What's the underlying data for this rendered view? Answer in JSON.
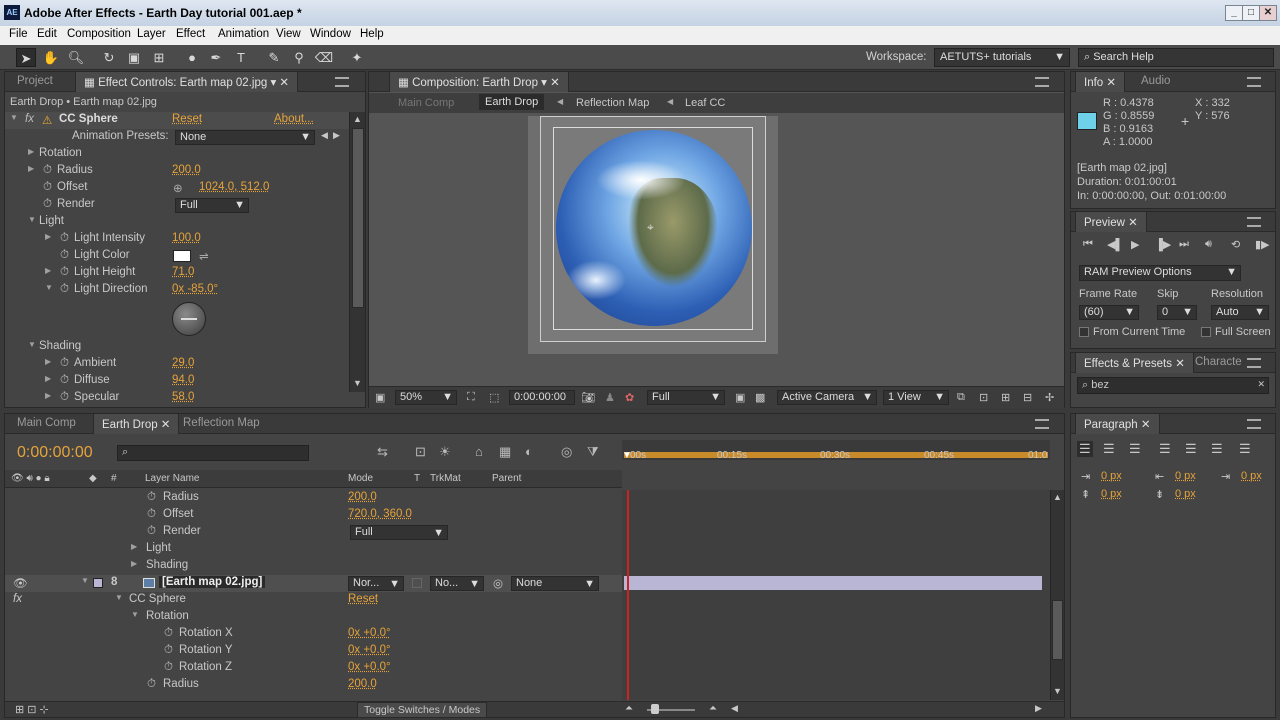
{
  "window": {
    "title": "Adobe After Effects - Earth Day tutorial 001.aep *",
    "logo": "AE",
    "min": "_",
    "max": "□",
    "close": "✕"
  },
  "menu": [
    "File",
    "Edit",
    "Composition",
    "Layer",
    "Effect",
    "Animation",
    "View",
    "Window",
    "Help"
  ],
  "toolbar": {
    "workspace_label": "Workspace:",
    "workspace_value": "AETUTS+ tutorials",
    "search_placeholder": "Search Help"
  },
  "left_panel": {
    "tabs": [
      "Project",
      "Effect Controls: Earth map 02.jpg"
    ],
    "breadcrumb": "Earth Drop • Earth map 02.jpg",
    "effect": {
      "fx": "fx",
      "name": "CC Sphere",
      "reset": "Reset",
      "about": "About...",
      "presets_label": "Animation Presets:",
      "presets_value": "None"
    },
    "props": {
      "rotation": "Rotation",
      "radius": {
        "label": "Radius",
        "value": "200.0"
      },
      "offset": {
        "label": "Offset",
        "value": "1024.0, 512.0"
      },
      "render": {
        "label": "Render",
        "value": "Full"
      },
      "light": "Light",
      "light_intensity": {
        "label": "Light Intensity",
        "value": "100.0"
      },
      "light_color": {
        "label": "Light Color"
      },
      "light_height": {
        "label": "Light Height",
        "value": "71.0"
      },
      "light_direction": {
        "label": "Light Direction",
        "value": "0x -85.0°"
      },
      "shading": "Shading",
      "ambient": {
        "label": "Ambient",
        "value": "29.0"
      },
      "diffuse": {
        "label": "Diffuse",
        "value": "94.0"
      },
      "specular": {
        "label": "Specular",
        "value": "58.0"
      }
    }
  },
  "comp_panel": {
    "tab": "Composition: Earth Drop",
    "crumbs": [
      "Main Comp",
      "Earth Drop",
      "Reflection Map",
      "Leaf CC"
    ],
    "zoom": "50%",
    "timecode": "0:00:00:00",
    "resolution": "Full",
    "camera": "Active Camera",
    "view": "1 View"
  },
  "info_panel": {
    "tabs": [
      "Info",
      "Audio"
    ],
    "r": "R : 0.4378",
    "g": "G : 0.8559",
    "b": "B : 0.9163",
    "a": "A : 1.0000",
    "x": "X : 332",
    "y": "Y : 576",
    "swatch_color": "#6fd0ea",
    "file": "[Earth map 02.jpg]",
    "duration": "Duration: 0:01:00:01",
    "inout": "In: 0:00:00:00, Out: 0:01:00:00"
  },
  "preview_panel": {
    "tab": "Preview",
    "ram_options": "RAM Preview Options",
    "frame_rate_label": "Frame Rate",
    "skip_label": "Skip",
    "resolution_label": "Resolution",
    "frame_rate": "(60)",
    "skip": "0",
    "resolution": "Auto",
    "from_current": "From Current Time",
    "full_screen": "Full Screen"
  },
  "effects_panel": {
    "tabs": [
      "Effects & Presets",
      "Characte"
    ],
    "search": "bez"
  },
  "paragraph_panel": {
    "tab": "Paragraph",
    "px": "0 px"
  },
  "timeline": {
    "tabs": [
      "Main Comp",
      "Earth Drop",
      "Reflection Map"
    ],
    "timecode": "0:00:00:00",
    "cols": {
      "hash": "#",
      "layer": "Layer Name",
      "mode": "Mode",
      "t": "T",
      "trkmat": "TrkMat",
      "parent": "Parent"
    },
    "ruler": [
      "00s",
      "00:15s",
      "00:30s",
      "00:45s",
      "01:0"
    ],
    "rows": [
      {
        "label": "Radius",
        "value": "200.0"
      },
      {
        "label": "Offset",
        "value": "720.0, 360.0"
      },
      {
        "label": "Render",
        "value": "Full"
      },
      {
        "label": "Light"
      },
      {
        "label": "Shading"
      }
    ],
    "layer": {
      "num": "8",
      "name": "[Earth map 02.jpg]",
      "mode": "Nor...",
      "trkmat": "No...",
      "parent": "None"
    },
    "effect": {
      "name": "CC Sphere",
      "reset": "Reset",
      "sub": "Rotation",
      "rx": {
        "label": "Rotation X",
        "value": "0x +0.0°"
      },
      "ry": {
        "label": "Rotation Y",
        "value": "0x +0.0°"
      },
      "rz": {
        "label": "Rotation Z",
        "value": "0x +0.0°"
      },
      "radius": {
        "label": "Radius",
        "value": "200.0"
      }
    },
    "toggle": "Toggle Switches / Modes"
  }
}
